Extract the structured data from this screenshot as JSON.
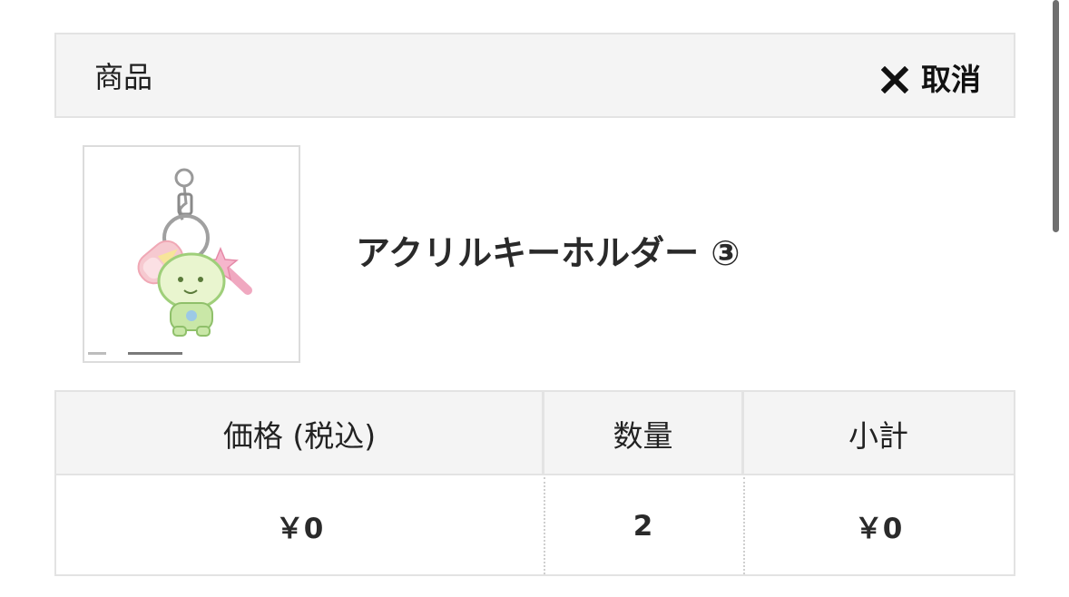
{
  "header": {
    "title": "商品",
    "cancel_label": "取消"
  },
  "product": {
    "name": "アクリルキーホルダー ③"
  },
  "table": {
    "headers": [
      "価格 (税込)",
      "数量",
      "小計"
    ],
    "row": {
      "price": "￥0",
      "quantity": "2",
      "subtotal": "￥0"
    }
  },
  "icons": {
    "cancel": "x-icon"
  }
}
